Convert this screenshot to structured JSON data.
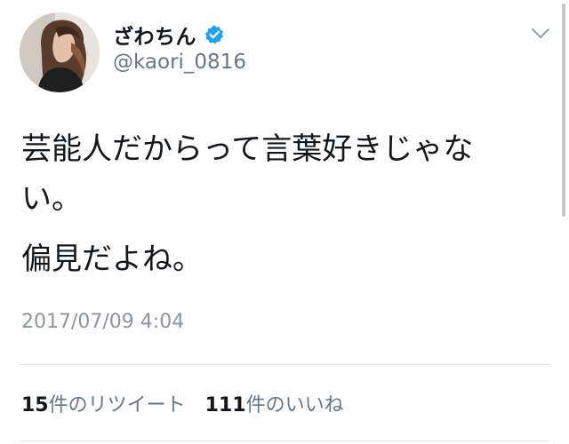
{
  "user": {
    "display_name": "ざわちん",
    "handle": "@kaori_0816",
    "verified": true,
    "verified_color": "#1da1f2"
  },
  "tweet": {
    "paragraphs": [
      "芸能人だからって言葉好きじゃない。",
      "偏見だよね。"
    ],
    "timestamp": "2017/07/09 4:04"
  },
  "stats": {
    "retweets": {
      "count": "15",
      "label": "件のリツイート"
    },
    "likes": {
      "count": "111",
      "label": "件のいいね"
    }
  },
  "icons": {
    "verified": "verified-badge-icon",
    "menu": "chevron-down-icon"
  },
  "colors": {
    "text": "#14171a",
    "secondary": "#657786",
    "divider": "#e1e8ed"
  }
}
